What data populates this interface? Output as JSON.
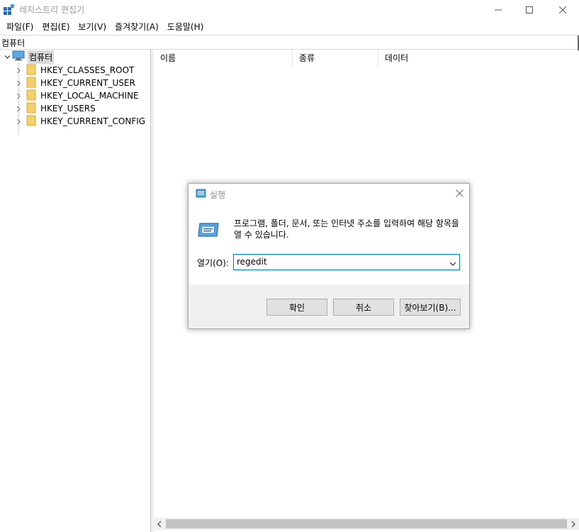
{
  "window": {
    "title": "레지스트리 편집기",
    "minimize_icon": "minimize-icon",
    "maximize_icon": "maximize-icon",
    "close_icon": "close-icon"
  },
  "menu": {
    "items": [
      "파일(F)",
      "편집(E)",
      "보기(V)",
      "즐겨찾기(A)",
      "도움말(H)"
    ]
  },
  "address": {
    "path": "컴퓨터"
  },
  "tree": {
    "root_label": "컴퓨터",
    "children": [
      "HKEY_CLASSES_ROOT",
      "HKEY_CURRENT_USER",
      "HKEY_LOCAL_MACHINE",
      "HKEY_USERS",
      "HKEY_CURRENT_CONFIG"
    ]
  },
  "list": {
    "columns": [
      "이름",
      "종류",
      "데이터"
    ]
  },
  "run_dialog": {
    "title": "실행",
    "description": "프로그램, 폴더, 문서, 또는 인터넷 주소를 입력하여 해당 항목을 열 수 있습니다.",
    "open_label": "열기(O):",
    "input_value": "regedit",
    "ok_label": "확인",
    "cancel_label": "취소",
    "browse_label": "찾아보기(B)..."
  },
  "colors": {
    "accent": "#0078d7",
    "folder": "#f4cf6b",
    "selection": "#d9d9d9"
  }
}
